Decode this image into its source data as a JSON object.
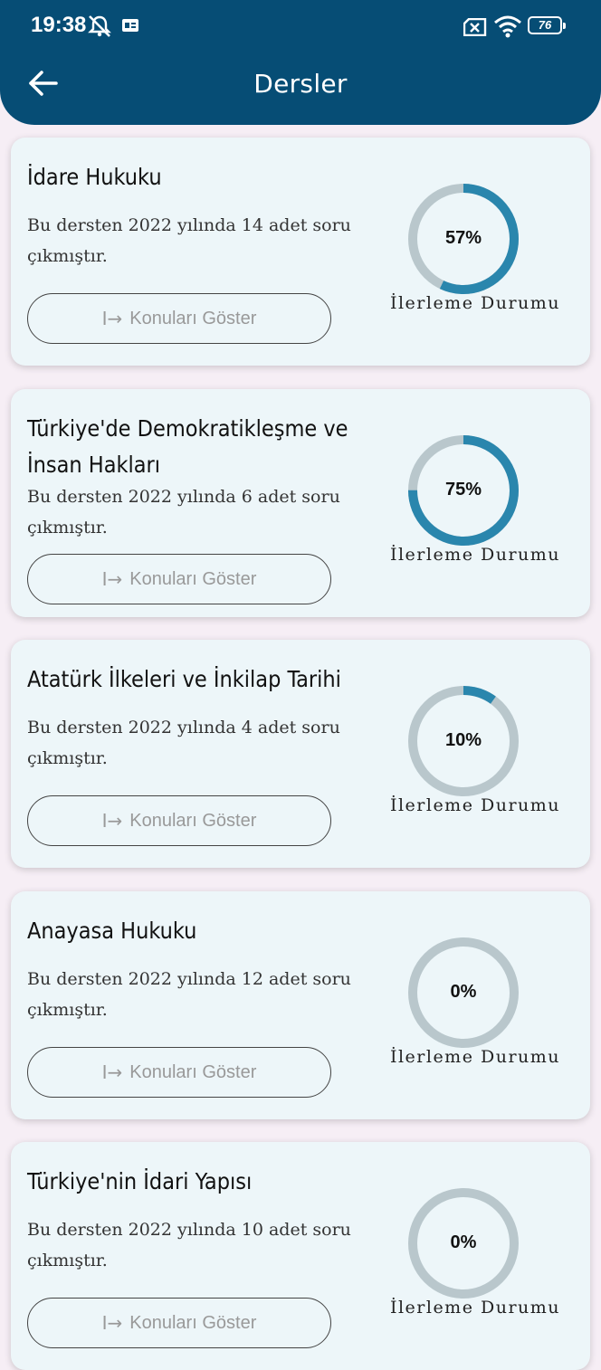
{
  "status_bar": {
    "time": "19:38",
    "battery": "76"
  },
  "app_bar": {
    "title": "Dersler",
    "back_icon": "arrow-left-icon"
  },
  "colors": {
    "app_bar": "#064d75",
    "progress": "#2a86ad",
    "track": "#b9c7cc",
    "card": "#edf6f9"
  },
  "progress_label": "İlerleme Durumu",
  "button_label": "Konuları Göster",
  "button_icon": "arrow-right-to-bar-icon",
  "courses": [
    {
      "title": "İdare Hukuku",
      "description": "Bu dersten 2022 yılında 14 adet soru çıkmıştır.",
      "progress": 57,
      "progress_text": "57%"
    },
    {
      "title": "Türkiye'de Demokratikleşme ve İnsan Hakları",
      "description": "Bu dersten 2022 yılında 6 adet soru çıkmıştır.",
      "progress": 75,
      "progress_text": "75%"
    },
    {
      "title": "Atatürk İlkeleri ve İnkilap Tarihi",
      "description": "Bu dersten 2022 yılında 4 adet soru çıkmıştır.",
      "progress": 10,
      "progress_text": "10%"
    },
    {
      "title": "Anayasa Hukuku",
      "description": "Bu dersten 2022 yılında 12 adet soru çıkmıştır.",
      "progress": 0,
      "progress_text": "0%"
    },
    {
      "title": "Türkiye'nin İdari Yapısı",
      "description": "Bu dersten 2022 yılında 10 adet soru çıkmıştır.",
      "progress": 0,
      "progress_text": "0%"
    }
  ]
}
